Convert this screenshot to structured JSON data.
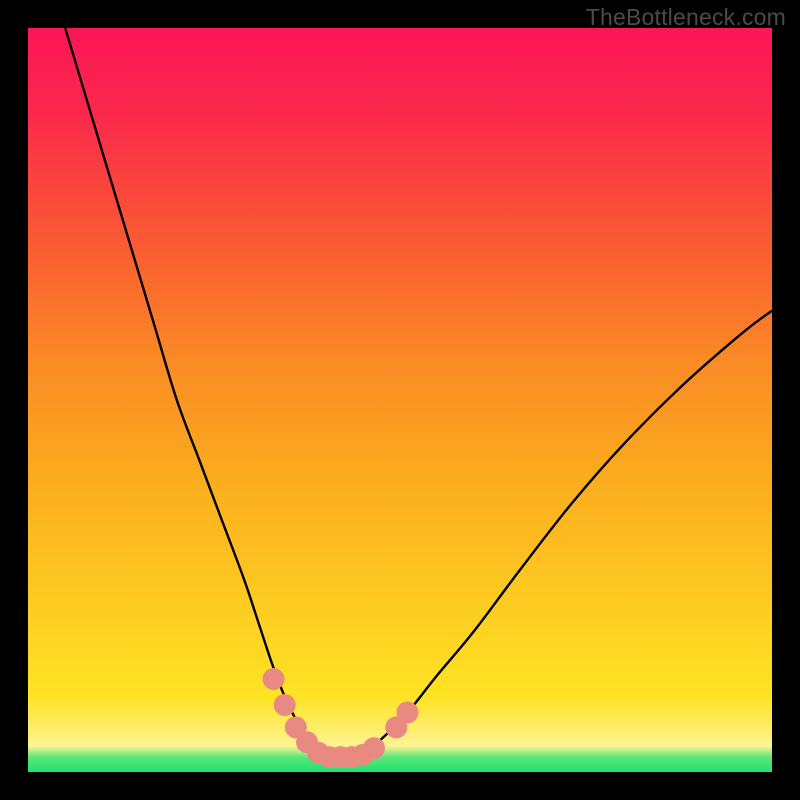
{
  "watermark": "TheBottleneck.com",
  "colors": {
    "black": "#000000",
    "curve": "#000000",
    "dots_fill": "#e88a82",
    "dots_stroke": "#d76a62",
    "green": "#1ee26f",
    "green_mid": "#5be87a",
    "yellow_soft": "#fef393",
    "yellow": "#fee324",
    "orange": "#fbab1e",
    "orange2": "#fa8b25",
    "redish": "#f95e31",
    "pink_red": "#fa2a4b",
    "top_red": "#fb1556"
  },
  "chart_data": {
    "type": "line",
    "title": "",
    "xlabel": "",
    "ylabel": "",
    "xlim": [
      0,
      100
    ],
    "ylim": [
      0,
      100
    ],
    "series": [
      {
        "name": "bottleneck-curve",
        "x": [
          5,
          8,
          11,
          14,
          17,
          20,
          23,
          26,
          29,
          31,
          33,
          35,
          37,
          39,
          40.5,
          42,
          44,
          47,
          51,
          55,
          60,
          66,
          73,
          80,
          88,
          96,
          100
        ],
        "values": [
          100,
          90,
          80,
          70,
          60,
          50,
          42,
          34,
          26,
          20,
          14,
          9,
          5.5,
          3,
          2,
          2,
          2.2,
          4,
          8,
          13,
          19,
          27,
          36,
          44,
          52,
          59,
          62
        ]
      }
    ],
    "markers": {
      "name": "highlighted-points",
      "points": [
        {
          "x": 33.0,
          "y": 12.5
        },
        {
          "x": 34.5,
          "y": 9.0
        },
        {
          "x": 36.0,
          "y": 6.0
        },
        {
          "x": 37.5,
          "y": 4.0
        },
        {
          "x": 39.0,
          "y": 2.6
        },
        {
          "x": 40.5,
          "y": 2.0
        },
        {
          "x": 42.0,
          "y": 2.0
        },
        {
          "x": 43.5,
          "y": 2.0
        },
        {
          "x": 45.0,
          "y": 2.3
        },
        {
          "x": 46.5,
          "y": 3.2
        },
        {
          "x": 49.5,
          "y": 6.0
        },
        {
          "x": 51.0,
          "y": 8.0
        }
      ]
    },
    "gradient_bands": [
      {
        "y": 0,
        "color": "green"
      },
      {
        "y": 2,
        "color": "green_mid"
      },
      {
        "y": 3.5,
        "color": "yellow_soft"
      },
      {
        "y": 10,
        "color": "yellow"
      },
      {
        "y": 40,
        "color": "orange"
      },
      {
        "y": 55,
        "color": "orange2"
      },
      {
        "y": 70,
        "color": "redish"
      },
      {
        "y": 88,
        "color": "pink_red"
      },
      {
        "y": 100,
        "color": "top_red"
      }
    ]
  }
}
